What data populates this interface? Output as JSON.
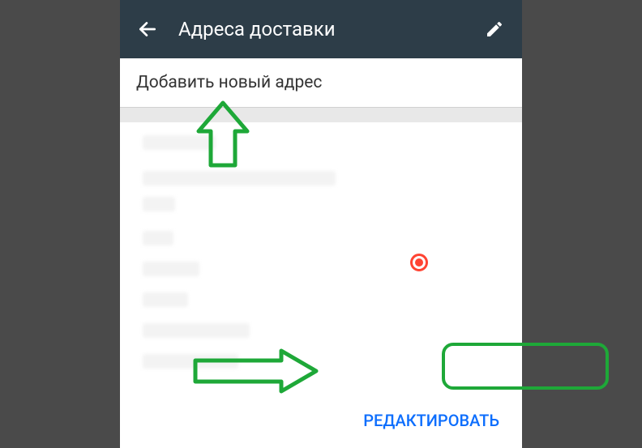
{
  "header": {
    "title": "Адреса доставки",
    "back_icon": "arrow-left",
    "edit_icon": "pencil"
  },
  "add_address": {
    "label": "Добавить новый адрес"
  },
  "address_card": {
    "edit_label": "РЕДАКТИРОВАТЬ",
    "selected": true
  }
}
